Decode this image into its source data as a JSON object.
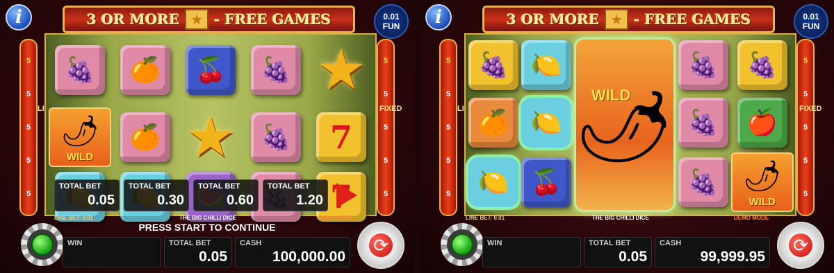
{
  "title": {
    "prefix": "3 OR MORE",
    "suffix": "- FREE GAMES"
  },
  "info_button": "i",
  "denomination": {
    "amount": "0.01",
    "currency": "FUN"
  },
  "lines_label": "LINES",
  "fixed_label": "FIXED",
  "rail_numbers": [
    "5",
    "5",
    "5",
    "5",
    "5",
    "5"
  ],
  "game_name": "THE BIG CHILLI DICE",
  "line_bet": "LINE BET: 0.01",
  "demo_mode": "DEMO MODE",
  "wild_label": "WILD",
  "colors": {
    "accent_gold": "#e7b34a",
    "banner_red": "#c8301a",
    "win_frame": "#8ff0a8",
    "play_arrow": "#e0201a"
  },
  "left_screen": {
    "prompt": "PRESS START TO CONTINUE",
    "bet_options": [
      {
        "label": "TOTAL BET",
        "value": "0.05"
      },
      {
        "label": "TOTAL BET",
        "value": "0.30"
      },
      {
        "label": "TOTAL BET",
        "value": "0.60"
      },
      {
        "label": "TOTAL BET",
        "value": "1.20"
      }
    ],
    "win": {
      "label": "WIN",
      "value": ""
    },
    "total_bet": {
      "label": "TOTAL BET",
      "value": "0.05"
    },
    "cash": {
      "label": "CASH",
      "value": "100,000.00"
    },
    "reels": [
      [
        "plum",
        "wild-chilli",
        "lemon"
      ],
      [
        "orange",
        "orange",
        "lemon"
      ],
      [
        "cherries",
        "star",
        "watermelon"
      ],
      [
        "plum",
        "plum",
        "plum"
      ],
      [
        "star",
        "seven",
        "seven"
      ]
    ]
  },
  "right_screen": {
    "win": {
      "label": "WIN",
      "value": ""
    },
    "total_bet": {
      "label": "TOTAL BET",
      "value": "0.05"
    },
    "cash": {
      "label": "CASH",
      "value": "99,999.95"
    },
    "reels": [
      [
        "grapes",
        "orange",
        "lemon"
      ],
      [
        "lemon",
        "lemon",
        "cherries"
      ],
      [
        "wild-chilli-expanded"
      ],
      [
        "plum",
        "plum",
        "plum"
      ],
      [
        "grapes",
        "apple",
        "wild-chilli"
      ]
    ],
    "winning_cells": [
      "reel-1-row-3",
      "reel-2-row-2",
      "reel-3-expanded"
    ]
  }
}
